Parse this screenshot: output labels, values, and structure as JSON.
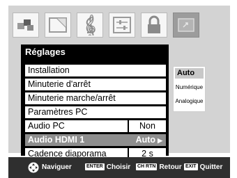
{
  "menu": {
    "title": "Réglages",
    "items": [
      {
        "label": "Installation",
        "value": ""
      },
      {
        "label": "Minuterie d'arrêt",
        "value": ""
      },
      {
        "label": "Minuterie marche/arrêt",
        "value": ""
      },
      {
        "label": "Paramètres PC",
        "value": ""
      },
      {
        "label": "Audio PC",
        "value": "Non"
      },
      {
        "label": "Audio HDMI 1",
        "value": "Auto"
      },
      {
        "label": "Cadence diaporama",
        "value": "2 s"
      }
    ],
    "selected_index": 5
  },
  "submenu": {
    "options": [
      "Auto",
      "Numérique",
      "Analogique"
    ],
    "current": "Auto"
  },
  "icons": [
    "picture-icon",
    "screen-icon",
    "music-note-icon",
    "settings-sliders-icon",
    "lock-icon",
    "application-icon"
  ],
  "bottom_bar": {
    "navigate": "Naviguer",
    "enter_key": "ENTER",
    "choose": "Choisir",
    "return_key": "CH RTN",
    "back": "Retour",
    "exit_key": "EXIT",
    "quit": "Quitter"
  },
  "colors": {
    "frame": "#d3d3d3",
    "menu_bg": "#000000",
    "selected_row": "#8e8e8e",
    "bottom_bar": "#2f2f2f"
  }
}
